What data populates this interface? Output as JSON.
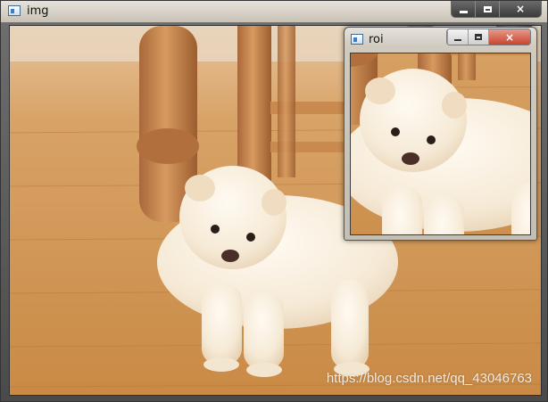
{
  "main_window": {
    "title": "img",
    "icon": "app-window-icon",
    "controls": {
      "minimize": "minimize-icon",
      "maximize": "maximize-icon",
      "close": "×"
    }
  },
  "roi_window": {
    "title": "roi",
    "icon": "app-window-icon",
    "controls": {
      "minimize": "minimize-icon",
      "maximize": "maximize-icon",
      "close": "×"
    }
  },
  "image": {
    "subject": "puppy-photo",
    "watermark": "https://blog.csdn.net/qq_43046763"
  },
  "colors": {
    "floor": "#d99a55",
    "floor_dark": "#b9763a",
    "wood_leg": "#b87a45",
    "puppy": "#f7eee0",
    "close_red": "#c8452f"
  }
}
